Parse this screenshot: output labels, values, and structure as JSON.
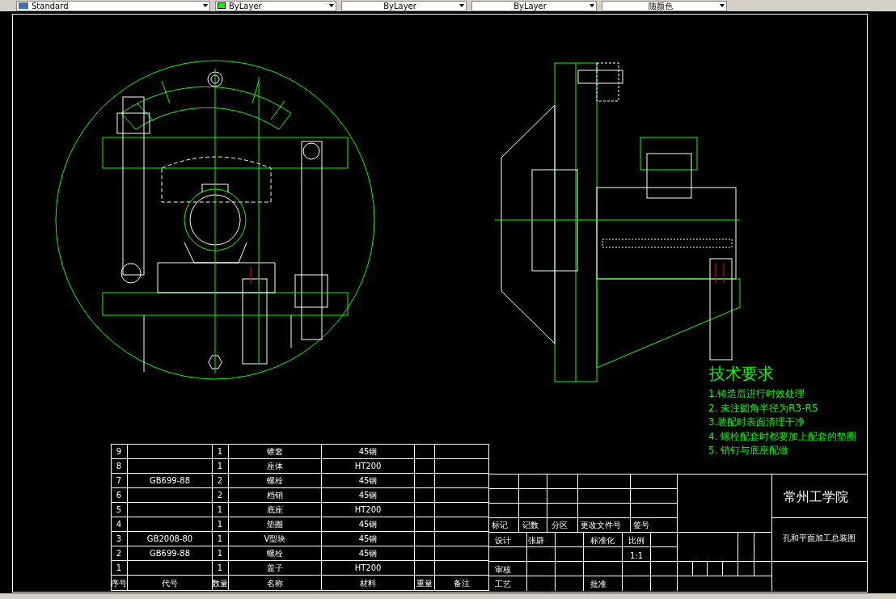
{
  "toolbar": [
    {
      "kind": "style",
      "text": "Standard"
    },
    {
      "kind": "layer",
      "text": "ByLayer"
    },
    {
      "kind": "plain",
      "text": "ByLayer"
    },
    {
      "kind": "plain",
      "text": "ByLayer"
    },
    {
      "kind": "plain",
      "text": "随颜色"
    }
  ],
  "parts_table": {
    "columns": [
      "序号",
      "代号",
      "数量",
      "名称",
      "材料",
      "重量",
      "备注"
    ],
    "rows": [
      {
        "no": "9",
        "code": "",
        "qty": "1",
        "name": "锥套",
        "material": "45钢"
      },
      {
        "no": "8",
        "code": "",
        "qty": "1",
        "name": "座体",
        "material": "HT200"
      },
      {
        "no": "7",
        "code": "GB699-88",
        "qty": "2",
        "name": "螺栓",
        "material": "45钢"
      },
      {
        "no": "6",
        "code": "",
        "qty": "2",
        "name": "档销",
        "material": "45钢"
      },
      {
        "no": "5",
        "code": "",
        "qty": "1",
        "name": "底座",
        "material": "HT200"
      },
      {
        "no": "4",
        "code": "",
        "qty": "1",
        "name": "垫圈",
        "material": "45钢"
      },
      {
        "no": "3",
        "code": "GB2008-80",
        "qty": "1",
        "name": "V型块",
        "material": "45钢"
      },
      {
        "no": "2",
        "code": "GB699-88",
        "qty": "1",
        "name": "螺栓",
        "material": "45钢"
      },
      {
        "no": "1",
        "code": "",
        "qty": "1",
        "name": "盖子",
        "material": "HT200"
      }
    ]
  },
  "title_block": {
    "cells": [
      "标记",
      "记数",
      "分区",
      "更改文件号",
      "签号",
      "设计",
      "张辟",
      "标准化",
      "比例",
      "1:1",
      "审核",
      "工艺",
      "批准"
    ],
    "school": "常州工学院",
    "drawing_title": "孔和平面加工总装图"
  },
  "tech_requirements": {
    "title": "技术要求",
    "items": [
      "1.铸造后进行时效处理",
      "2. 未注圆角半径为R3-R5",
      "3.装配时表面清理干净",
      "4. 螺栓配套时都要加上配套的垫圈",
      "5. 销钉与底座配做"
    ]
  }
}
